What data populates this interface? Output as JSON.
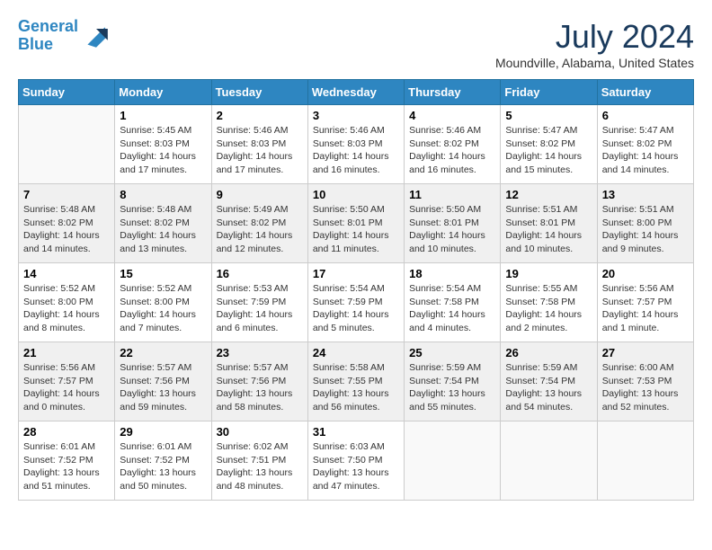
{
  "header": {
    "logo_line1": "General",
    "logo_line2": "Blue",
    "month_year": "July 2024",
    "location": "Moundville, Alabama, United States"
  },
  "days_of_week": [
    "Sunday",
    "Monday",
    "Tuesday",
    "Wednesday",
    "Thursday",
    "Friday",
    "Saturday"
  ],
  "weeks": [
    [
      {
        "day": "",
        "info": ""
      },
      {
        "day": "1",
        "info": "Sunrise: 5:45 AM\nSunset: 8:03 PM\nDaylight: 14 hours\nand 17 minutes."
      },
      {
        "day": "2",
        "info": "Sunrise: 5:46 AM\nSunset: 8:03 PM\nDaylight: 14 hours\nand 17 minutes."
      },
      {
        "day": "3",
        "info": "Sunrise: 5:46 AM\nSunset: 8:03 PM\nDaylight: 14 hours\nand 16 minutes."
      },
      {
        "day": "4",
        "info": "Sunrise: 5:46 AM\nSunset: 8:02 PM\nDaylight: 14 hours\nand 16 minutes."
      },
      {
        "day": "5",
        "info": "Sunrise: 5:47 AM\nSunset: 8:02 PM\nDaylight: 14 hours\nand 15 minutes."
      },
      {
        "day": "6",
        "info": "Sunrise: 5:47 AM\nSunset: 8:02 PM\nDaylight: 14 hours\nand 14 minutes."
      }
    ],
    [
      {
        "day": "7",
        "info": "Sunrise: 5:48 AM\nSunset: 8:02 PM\nDaylight: 14 hours\nand 14 minutes."
      },
      {
        "day": "8",
        "info": "Sunrise: 5:48 AM\nSunset: 8:02 PM\nDaylight: 14 hours\nand 13 minutes."
      },
      {
        "day": "9",
        "info": "Sunrise: 5:49 AM\nSunset: 8:02 PM\nDaylight: 14 hours\nand 12 minutes."
      },
      {
        "day": "10",
        "info": "Sunrise: 5:50 AM\nSunset: 8:01 PM\nDaylight: 14 hours\nand 11 minutes."
      },
      {
        "day": "11",
        "info": "Sunrise: 5:50 AM\nSunset: 8:01 PM\nDaylight: 14 hours\nand 10 minutes."
      },
      {
        "day": "12",
        "info": "Sunrise: 5:51 AM\nSunset: 8:01 PM\nDaylight: 14 hours\nand 10 minutes."
      },
      {
        "day": "13",
        "info": "Sunrise: 5:51 AM\nSunset: 8:00 PM\nDaylight: 14 hours\nand 9 minutes."
      }
    ],
    [
      {
        "day": "14",
        "info": "Sunrise: 5:52 AM\nSunset: 8:00 PM\nDaylight: 14 hours\nand 8 minutes."
      },
      {
        "day": "15",
        "info": "Sunrise: 5:52 AM\nSunset: 8:00 PM\nDaylight: 14 hours\nand 7 minutes."
      },
      {
        "day": "16",
        "info": "Sunrise: 5:53 AM\nSunset: 7:59 PM\nDaylight: 14 hours\nand 6 minutes."
      },
      {
        "day": "17",
        "info": "Sunrise: 5:54 AM\nSunset: 7:59 PM\nDaylight: 14 hours\nand 5 minutes."
      },
      {
        "day": "18",
        "info": "Sunrise: 5:54 AM\nSunset: 7:58 PM\nDaylight: 14 hours\nand 4 minutes."
      },
      {
        "day": "19",
        "info": "Sunrise: 5:55 AM\nSunset: 7:58 PM\nDaylight: 14 hours\nand 2 minutes."
      },
      {
        "day": "20",
        "info": "Sunrise: 5:56 AM\nSunset: 7:57 PM\nDaylight: 14 hours\nand 1 minute."
      }
    ],
    [
      {
        "day": "21",
        "info": "Sunrise: 5:56 AM\nSunset: 7:57 PM\nDaylight: 14 hours\nand 0 minutes."
      },
      {
        "day": "22",
        "info": "Sunrise: 5:57 AM\nSunset: 7:56 PM\nDaylight: 13 hours\nand 59 minutes."
      },
      {
        "day": "23",
        "info": "Sunrise: 5:57 AM\nSunset: 7:56 PM\nDaylight: 13 hours\nand 58 minutes."
      },
      {
        "day": "24",
        "info": "Sunrise: 5:58 AM\nSunset: 7:55 PM\nDaylight: 13 hours\nand 56 minutes."
      },
      {
        "day": "25",
        "info": "Sunrise: 5:59 AM\nSunset: 7:54 PM\nDaylight: 13 hours\nand 55 minutes."
      },
      {
        "day": "26",
        "info": "Sunrise: 5:59 AM\nSunset: 7:54 PM\nDaylight: 13 hours\nand 54 minutes."
      },
      {
        "day": "27",
        "info": "Sunrise: 6:00 AM\nSunset: 7:53 PM\nDaylight: 13 hours\nand 52 minutes."
      }
    ],
    [
      {
        "day": "28",
        "info": "Sunrise: 6:01 AM\nSunset: 7:52 PM\nDaylight: 13 hours\nand 51 minutes."
      },
      {
        "day": "29",
        "info": "Sunrise: 6:01 AM\nSunset: 7:52 PM\nDaylight: 13 hours\nand 50 minutes."
      },
      {
        "day": "30",
        "info": "Sunrise: 6:02 AM\nSunset: 7:51 PM\nDaylight: 13 hours\nand 48 minutes."
      },
      {
        "day": "31",
        "info": "Sunrise: 6:03 AM\nSunset: 7:50 PM\nDaylight: 13 hours\nand 47 minutes."
      },
      {
        "day": "",
        "info": ""
      },
      {
        "day": "",
        "info": ""
      },
      {
        "day": "",
        "info": ""
      }
    ]
  ]
}
